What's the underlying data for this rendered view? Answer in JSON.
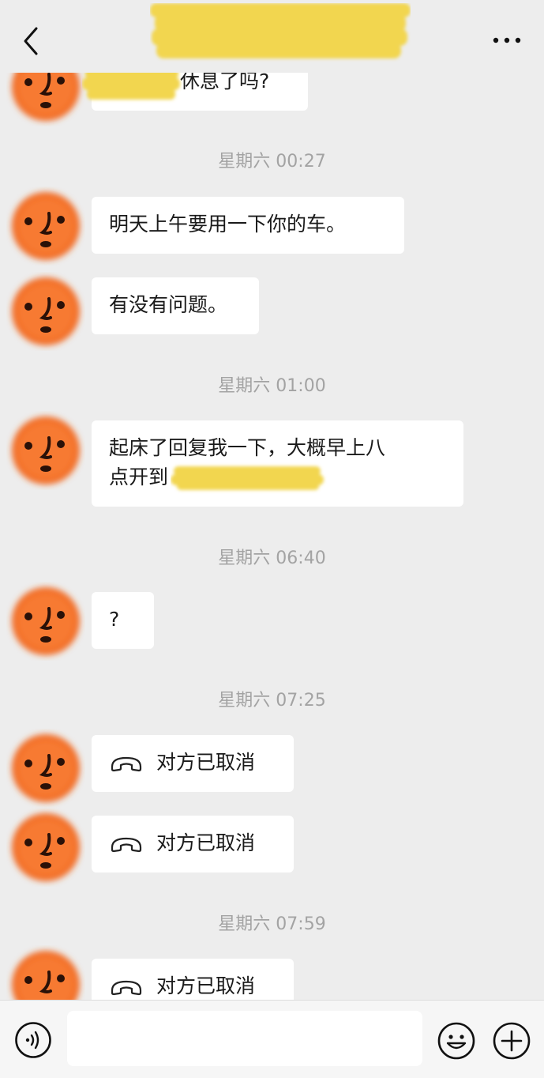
{
  "header": {
    "back_icon": "chevron-left-icon",
    "more_icon": "ellipsis-icon",
    "title_redacted_color": "#f2d650"
  },
  "messages": [
    {
      "type": "text",
      "text": "休息了吗?"
    },
    {
      "type": "time",
      "text": "星期六 00:27"
    },
    {
      "type": "text",
      "text": "明天上午要用一下你的车。"
    },
    {
      "type": "text",
      "text": "有没有问题。"
    },
    {
      "type": "time",
      "text": "星期六 01:00"
    },
    {
      "type": "text",
      "line1": "起床了回复我一下，大概早上八",
      "line2": "点开到"
    },
    {
      "type": "time",
      "text": "星期六 06:40"
    },
    {
      "type": "text",
      "text": "?"
    },
    {
      "type": "time",
      "text": "星期六 07:25"
    },
    {
      "type": "call",
      "text": "对方已取消",
      "icon": "phone-hangup-icon"
    },
    {
      "type": "call",
      "text": "对方已取消",
      "icon": "phone-hangup-icon"
    },
    {
      "type": "time",
      "text": "星期六 07:59"
    },
    {
      "type": "call",
      "text": "对方已取消",
      "icon": "phone-hangup-icon"
    }
  ],
  "input_bar": {
    "voice_icon": "voice-icon",
    "emoji_icon": "emoji-icon",
    "plus_icon": "plus-circle-icon",
    "placeholder": ""
  },
  "colors": {
    "background": "#ededed",
    "bubble": "#ffffff",
    "timestamp": "#a3a3a3",
    "avatar": "#f26a24",
    "redaction": "#f2d650"
  }
}
